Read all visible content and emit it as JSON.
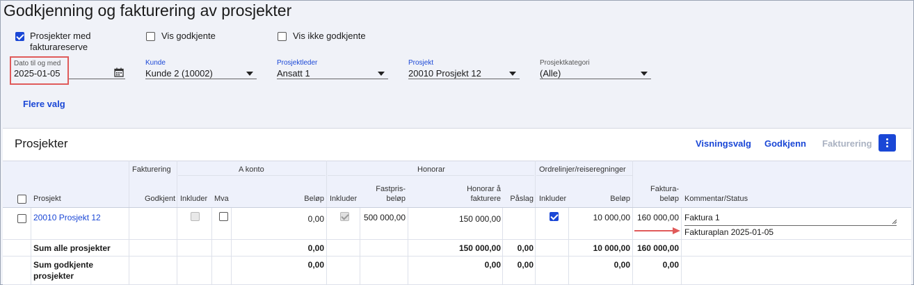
{
  "page": {
    "title": "Godkjenning og fakturering av prosjekter"
  },
  "filters": {
    "checkboxes": [
      {
        "label": "Prosjekter med fakturareserve",
        "checked": true
      },
      {
        "label": "Vis godkjente",
        "checked": false
      },
      {
        "label": "Vis ikke godkjente",
        "checked": false
      }
    ],
    "date": {
      "label": "Dato til og med",
      "value": "2025-01-05"
    },
    "kunde": {
      "label": "Kunde",
      "value": "Kunde 2 (10002)"
    },
    "prosjektleder": {
      "label": "Prosjektleder",
      "value": "Ansatt 1"
    },
    "prosjekt": {
      "label": "Prosjekt",
      "value": "20010 Prosjekt 12"
    },
    "kategori": {
      "label": "Prosjektkategori",
      "value": "(Alle)"
    },
    "more_label": "Flere valg"
  },
  "panel": {
    "title": "Prosjekter",
    "actions": {
      "visningsvalg": "Visningsvalg",
      "godkjenn": "Godkjenn",
      "fakturering": "Fakturering"
    }
  },
  "table": {
    "groups": {
      "fakturering": "Fakturering",
      "akonto": "A konto",
      "honorar": "Honorar",
      "ordrelinjer": "Ordrelinjer/reiseregninger"
    },
    "columns": {
      "prosjekt": "Prosjekt",
      "godkjent": "Godkjent",
      "ak_inkluder": "Inkluder",
      "ak_mva": "Mva",
      "ak_belop": "Beløp",
      "ho_inkluder": "Inkluder",
      "ho_fastpris_1": "Fastpris-",
      "ho_fastpris_2": "beløp",
      "ho_honorar_1": "Honorar å",
      "ho_honorar_2": "fakturere",
      "ho_paslag": "Påslag",
      "or_inkluder": "Inkluder",
      "or_belop": "Beløp",
      "fb_1": "Faktura-",
      "fb_2": "beløp",
      "kommentar": "Kommentar/Status"
    },
    "row": {
      "prosjekt": "20010 Prosjekt 12",
      "ak_belop": "0,00",
      "ho_fastpris": "500 000,00",
      "ho_honorar": "150 000,00",
      "or_belop": "10 000,00",
      "fakturabelop": "160 000,00",
      "kommentar": "Faktura 1",
      "status": "Fakturaplan 2025-01-05",
      "ak_inkluder_checked": false,
      "ak_mva_checked": false,
      "ho_inkluder_checked": true,
      "or_inkluder_checked": true
    },
    "sum_alle": {
      "label": "Sum alle prosjekter",
      "ak_belop": "0,00",
      "ho_honorar": "150 000,00",
      "ho_paslag": "0,00",
      "or_belop": "10 000,00",
      "fakturabelop": "160 000,00"
    },
    "sum_godkjente": {
      "label_1": "Sum godkjente",
      "label_2": "prosjekter",
      "ak_belop": "0,00",
      "ho_honorar": "0,00",
      "ho_paslag": "0,00",
      "or_belop": "0,00",
      "fakturabelop": "0,00"
    }
  },
  "colors": {
    "accent": "#1a47d6",
    "highlight": "#e05a5a",
    "header_bg": "#eef1fb"
  }
}
